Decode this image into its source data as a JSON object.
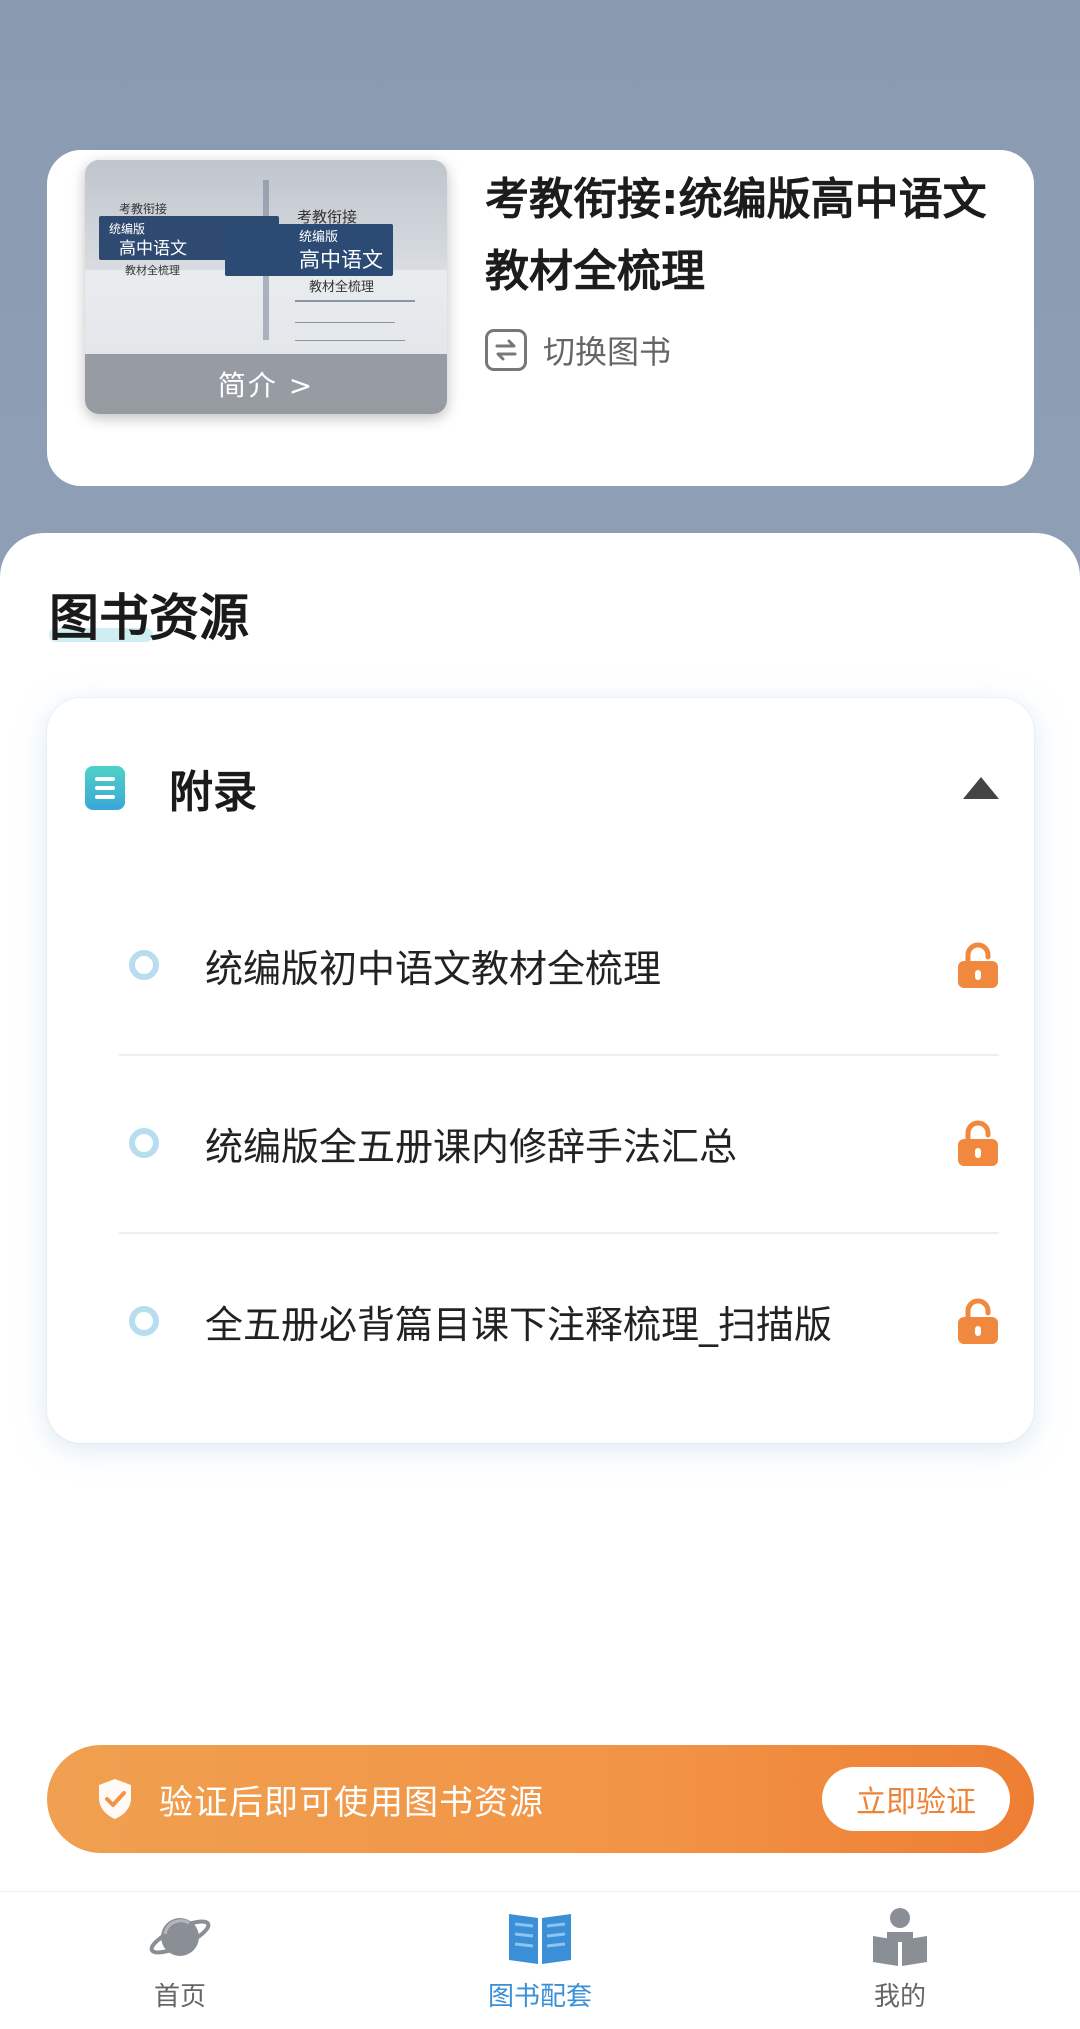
{
  "book": {
    "title": "考教衔接:统编版高中语文教材全梳理",
    "cover_intro": "简介 >",
    "switch_label": "切换图书",
    "cover_text": {
      "series": "考教衔接",
      "edition": "统编版",
      "subject": "高中语文",
      "subtitle": "教材全梳理"
    }
  },
  "resources": {
    "section_title": "图书资源",
    "panel_title": "附录",
    "items": [
      {
        "label": "统编版初中语文教材全梳理",
        "locked": true
      },
      {
        "label": "统编版全五册课内修辞手法汇总",
        "locked": true
      },
      {
        "label": "全五册必背篇目课下注释梳理_扫描版",
        "locked": true
      }
    ]
  },
  "verify": {
    "message": "验证后即可使用图书资源",
    "button_label": "立即验证"
  },
  "nav": {
    "items": [
      {
        "label": "首页",
        "icon": "planet-icon",
        "active": false
      },
      {
        "label": "图书配套",
        "icon": "open-book-icon",
        "active": true
      },
      {
        "label": "我的",
        "icon": "reader-icon",
        "active": false
      }
    ]
  },
  "colors": {
    "accent_blue": "#3a8fd6",
    "lock_orange": "#f0883e",
    "verify_orange": "#f29446"
  }
}
